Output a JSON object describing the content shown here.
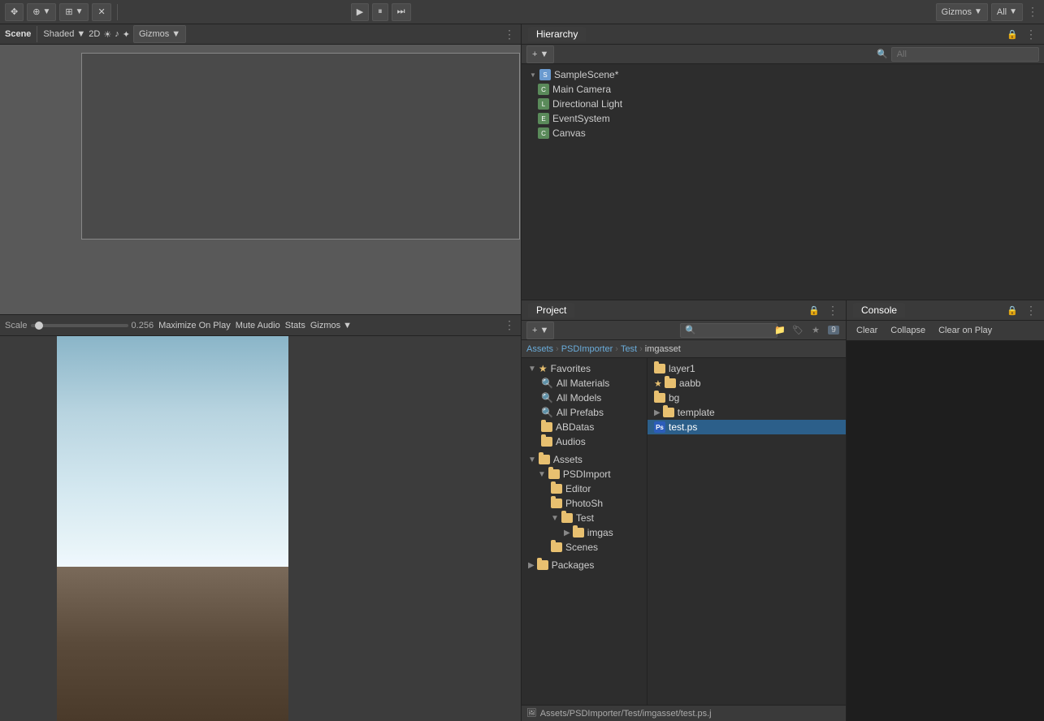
{
  "topToolbar": {
    "gizmosLabel": "Gizmos",
    "allLabel": "All",
    "moreIcon": "⋮"
  },
  "sceneView": {
    "title": "Scene"
  },
  "gameView": {
    "scaleLabel": "Scale",
    "scaleValue": "0.256",
    "maximizeOnPlayLabel": "Maximize On Play",
    "muteAudioLabel": "Mute Audio",
    "statsLabel": "Stats",
    "gizmosLabel": "Gizmos"
  },
  "hierarchy": {
    "title": "Hierarchy",
    "searchPlaceholder": "All",
    "scene": "SampleScene*",
    "items": [
      {
        "label": "Main Camera",
        "indent": 1
      },
      {
        "label": "Directional Light",
        "indent": 1
      },
      {
        "label": "EventSystem",
        "indent": 1
      },
      {
        "label": "Canvas",
        "indent": 1
      }
    ]
  },
  "project": {
    "title": "Project",
    "searchPlaceholder": "",
    "breadcrumb": [
      "Assets",
      "PSDImporter",
      "Test",
      "imgasset"
    ],
    "numBadge": "9",
    "favorites": {
      "label": "Favorites",
      "items": [
        {
          "label": "All Materials"
        },
        {
          "label": "All Models"
        },
        {
          "label": "All Prefabs"
        },
        {
          "label": "ABDatas"
        },
        {
          "label": "Audios"
        }
      ]
    },
    "assets": {
      "label": "Assets",
      "items": [
        {
          "label": "PSDImport",
          "expanded": true,
          "indent": 1
        },
        {
          "label": "Editor",
          "indent": 2
        },
        {
          "label": "PhotoSh",
          "indent": 2
        },
        {
          "label": "Test",
          "expanded": true,
          "indent": 2
        },
        {
          "label": "imgas",
          "indent": 3
        },
        {
          "label": "Scenes",
          "indent": 2
        }
      ]
    },
    "packages": {
      "label": "Packages"
    },
    "fileList": [
      {
        "label": "layer1",
        "type": "folder"
      },
      {
        "label": "aabb",
        "type": "folder",
        "starred": true
      },
      {
        "label": "bg",
        "type": "folder"
      },
      {
        "label": "template",
        "type": "folder"
      },
      {
        "label": "test.ps",
        "type": "file",
        "selected": true
      }
    ],
    "statusBar": "Assets/PSDImporter/Test/imgasset/test.ps.j"
  },
  "console": {
    "title": "Console",
    "clearLabel": "Clear",
    "collapseLabel": "Collapse",
    "clearOnPlayLabel": "Clear on Play",
    "moreIcon": "⋮"
  }
}
